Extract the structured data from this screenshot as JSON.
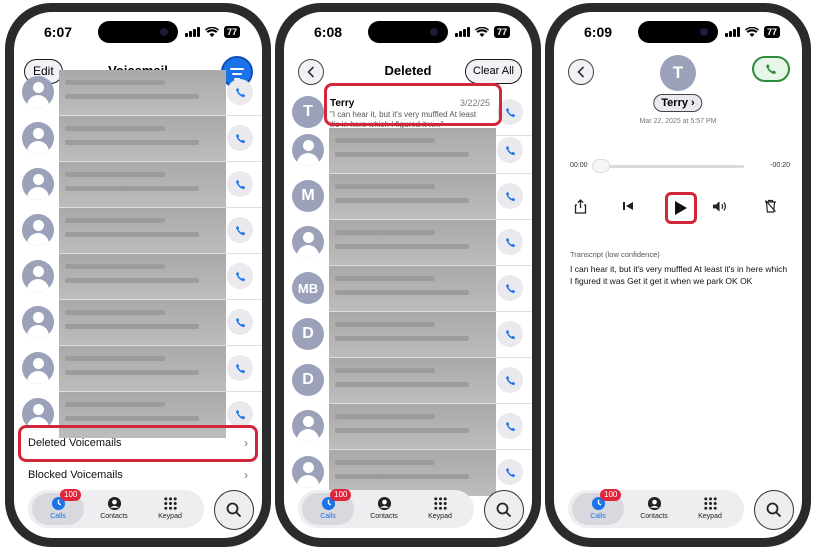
{
  "phone1": {
    "time": "6:07",
    "battery": "77",
    "edit_label": "Edit",
    "title": "Voicemail",
    "deleted_label": "Deleted Voicemails",
    "blocked_label": "Blocked Voicemails"
  },
  "phone2": {
    "time": "6:08",
    "battery": "77",
    "title": "Deleted",
    "clear_label": "Clear All",
    "terry": {
      "initial": "T",
      "name": "Terry",
      "date": "3/22/25",
      "snippet": "\"I can hear it, but it's very muffled At least it's in here which I figured it w...\""
    },
    "avatars": [
      {
        "initial": ""
      },
      {
        "initial": "M"
      },
      {
        "initial": ""
      },
      {
        "initial": "MB"
      },
      {
        "initial": "D"
      },
      {
        "initial": "D"
      },
      {
        "initial": ""
      },
      {
        "initial": ""
      }
    ]
  },
  "phone3": {
    "time": "6:09",
    "battery": "77",
    "initial": "T",
    "name": "Terry",
    "date": "Mar 22, 2025 at 5:57 PM",
    "elapsed": "00:00",
    "remaining": "-00:20",
    "transcript_label": "Transcript (low confidence)",
    "transcript": "I can hear it, but it's very muffled At least it's in here which I figured it was Get it get it when we park OK OK"
  },
  "tabbar": {
    "calls_label": "Calls",
    "contacts_label": "Contacts",
    "keypad_label": "Keypad",
    "badge": "100"
  },
  "colors": {
    "accent": "#1a73e8",
    "highlight": "#d3263a",
    "green": "#2e8b3a"
  }
}
